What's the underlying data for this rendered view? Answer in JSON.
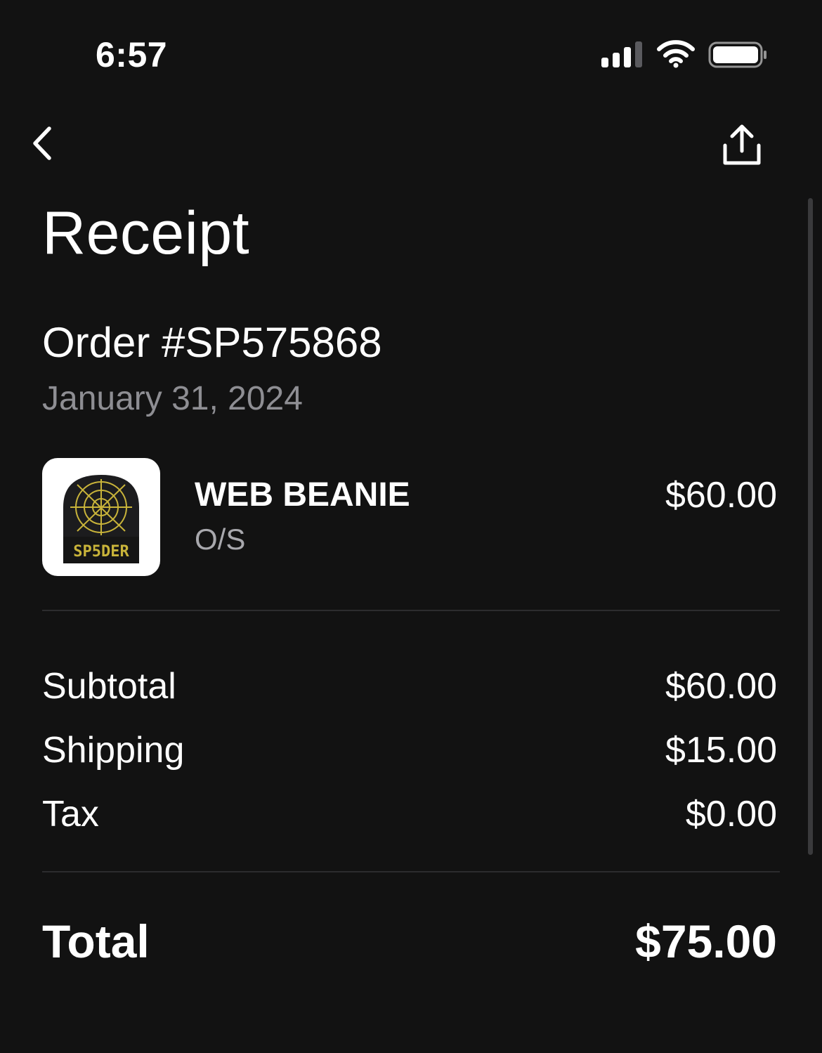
{
  "status_bar": {
    "time": "6:57",
    "icons": [
      "cellular-signal-icon",
      "wifi-icon",
      "battery-icon"
    ]
  },
  "nav": {
    "back_icon": "chevron-left-icon",
    "share_icon": "share-icon"
  },
  "page": {
    "title": "Receipt"
  },
  "order": {
    "number": "Order #SP575868",
    "date": "January 31, 2024"
  },
  "items": [
    {
      "name": "WEB BEANIE",
      "size": "O/S",
      "price": "$60.00",
      "thumbnail_text": "SP5DER"
    }
  ],
  "summary": {
    "subtotal_label": "Subtotal",
    "subtotal_value": "$60.00",
    "shipping_label": "Shipping",
    "shipping_value": "$15.00",
    "tax_label": "Tax",
    "tax_value": "$0.00"
  },
  "total": {
    "label": "Total",
    "value": "$75.00"
  },
  "colors": {
    "background": "#121212",
    "text_primary": "#ffffff",
    "text_secondary": "#8e8e93",
    "divider": "#2c2c2e",
    "beanie_body": "#1c1c1e",
    "beanie_web": "#c9b43a"
  }
}
